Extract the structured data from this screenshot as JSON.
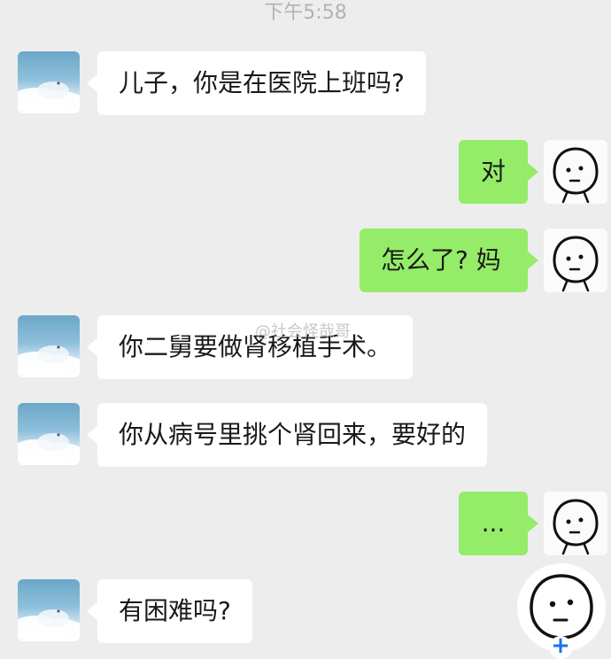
{
  "status": {
    "time": "下午5:58"
  },
  "contact": {
    "avatar_icon": "sky-clouds-avatar"
  },
  "me": {
    "avatar_icon": "stick-face-avatar"
  },
  "messages": [
    {
      "side": "left",
      "text": "儿子，你是在医院上班吗?"
    },
    {
      "side": "right",
      "text": "对"
    },
    {
      "side": "right",
      "text": "怎么了? 妈"
    },
    {
      "side": "left",
      "text": "你二舅要做肾移植手术。"
    },
    {
      "side": "left",
      "text": "你从病号里挑个肾回来，要好的"
    },
    {
      "side": "right",
      "text": "..."
    },
    {
      "side": "left",
      "text": "有困难吗?"
    }
  ],
  "watermark": "@社会怪哉哥",
  "floating_button": {
    "icon": "stick-face-icon",
    "badge": "+"
  },
  "colors": {
    "background": "#ededed",
    "incoming_bubble": "#ffffff",
    "outgoing_bubble": "#95ec69",
    "timestamp": "#b3b3b3"
  }
}
